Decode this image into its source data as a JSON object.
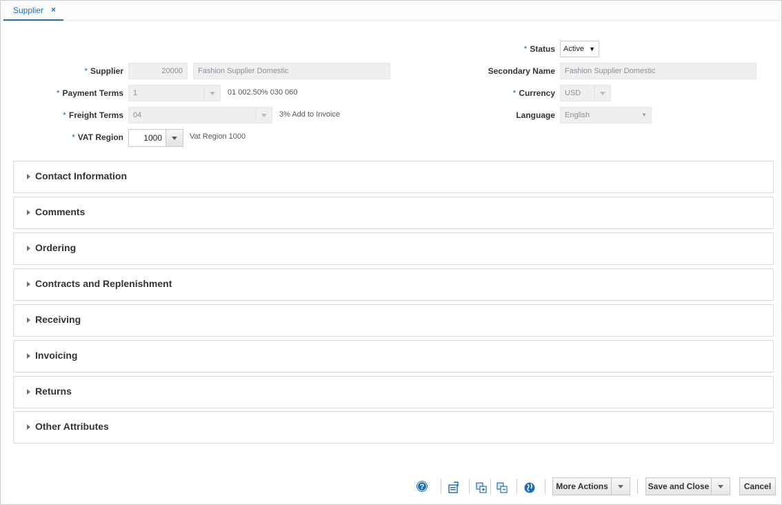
{
  "tab": {
    "label": "Supplier",
    "close": "×"
  },
  "form": {
    "required_marker": "*",
    "supplier": {
      "label": "Supplier",
      "id": "20000",
      "name": "Fashion Supplier Domestic"
    },
    "payment_terms": {
      "label": "Payment Terms",
      "value": "1",
      "description": "01 002.50% 030 060"
    },
    "freight_terms": {
      "label": "Freight Terms",
      "value": "04",
      "description": "3% Add to Invoice"
    },
    "vat_region": {
      "label": "VAT Region",
      "value": "1000",
      "description": "Vat Region 1000"
    },
    "status": {
      "label": "Status",
      "value": "Active"
    },
    "secondary_name": {
      "label": "Secondary Name",
      "value": "Fashion Supplier Domestic"
    },
    "currency": {
      "label": "Currency",
      "value": "USD"
    },
    "language": {
      "label": "Language",
      "value": "English"
    }
  },
  "sections": [
    "Contact Information",
    "Comments",
    "Ordering",
    "Contracts and Replenishment",
    "Receiving",
    "Invoicing",
    "Returns",
    "Other Attributes"
  ],
  "toolbar": {
    "icons": [
      "help-icon",
      "export-icon",
      "attach-icon",
      "copy-icon",
      "globe-icon"
    ],
    "more_actions": "More Actions",
    "save_and_close": "Save and Close",
    "cancel": "Cancel"
  },
  "colors": {
    "accent": "#1c6fb4",
    "border": "#d6dbe0"
  }
}
